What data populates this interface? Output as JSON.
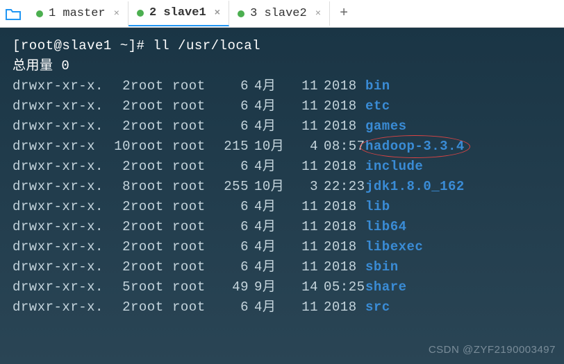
{
  "tabs": [
    {
      "label": "1 master",
      "active": false
    },
    {
      "label": "2 slave1",
      "active": true
    },
    {
      "label": "3 slave2",
      "active": false
    }
  ],
  "prompt": "[root@slave1 ~]# ",
  "command": "ll /usr/local",
  "total_label": "总用量 0",
  "rows": [
    {
      "perm": "drwxr-xr-x.",
      "links": "2",
      "owner": "root",
      "group": "root",
      "size": "6",
      "month": "4月",
      "day": "11",
      "time": "2018",
      "name": "bin"
    },
    {
      "perm": "drwxr-xr-x.",
      "links": "2",
      "owner": "root",
      "group": "root",
      "size": "6",
      "month": "4月",
      "day": "11",
      "time": "2018",
      "name": "etc"
    },
    {
      "perm": "drwxr-xr-x.",
      "links": "2",
      "owner": "root",
      "group": "root",
      "size": "6",
      "month": "4月",
      "day": "11",
      "time": "2018",
      "name": "games"
    },
    {
      "perm": "drwxr-xr-x",
      "links": "10",
      "owner": "root",
      "group": "root",
      "size": "215",
      "month": "10月",
      "day": "4",
      "time": "08:57",
      "name": "hadoop-3.3.4",
      "highlight": true
    },
    {
      "perm": "drwxr-xr-x.",
      "links": "2",
      "owner": "root",
      "group": "root",
      "size": "6",
      "month": "4月",
      "day": "11",
      "time": "2018",
      "name": "include"
    },
    {
      "perm": "drwxr-xr-x.",
      "links": "8",
      "owner": "root",
      "group": "root",
      "size": "255",
      "month": "10月",
      "day": "3",
      "time": "22:23",
      "name": "jdk1.8.0_162"
    },
    {
      "perm": "drwxr-xr-x.",
      "links": "2",
      "owner": "root",
      "group": "root",
      "size": "6",
      "month": "4月",
      "day": "11",
      "time": "2018",
      "name": "lib"
    },
    {
      "perm": "drwxr-xr-x.",
      "links": "2",
      "owner": "root",
      "group": "root",
      "size": "6",
      "month": "4月",
      "day": "11",
      "time": "2018",
      "name": "lib64"
    },
    {
      "perm": "drwxr-xr-x.",
      "links": "2",
      "owner": "root",
      "group": "root",
      "size": "6",
      "month": "4月",
      "day": "11",
      "time": "2018",
      "name": "libexec"
    },
    {
      "perm": "drwxr-xr-x.",
      "links": "2",
      "owner": "root",
      "group": "root",
      "size": "6",
      "month": "4月",
      "day": "11",
      "time": "2018",
      "name": "sbin"
    },
    {
      "perm": "drwxr-xr-x.",
      "links": "5",
      "owner": "root",
      "group": "root",
      "size": "49",
      "month": "9月",
      "day": "14",
      "time": "05:25",
      "name": "share"
    },
    {
      "perm": "drwxr-xr-x.",
      "links": "2",
      "owner": "root",
      "group": "root",
      "size": "6",
      "month": "4月",
      "day": "11",
      "time": "2018",
      "name": "src"
    }
  ],
  "watermark": "CSDN @ZYF2190003497",
  "add_tab": "+",
  "close_x": "×"
}
